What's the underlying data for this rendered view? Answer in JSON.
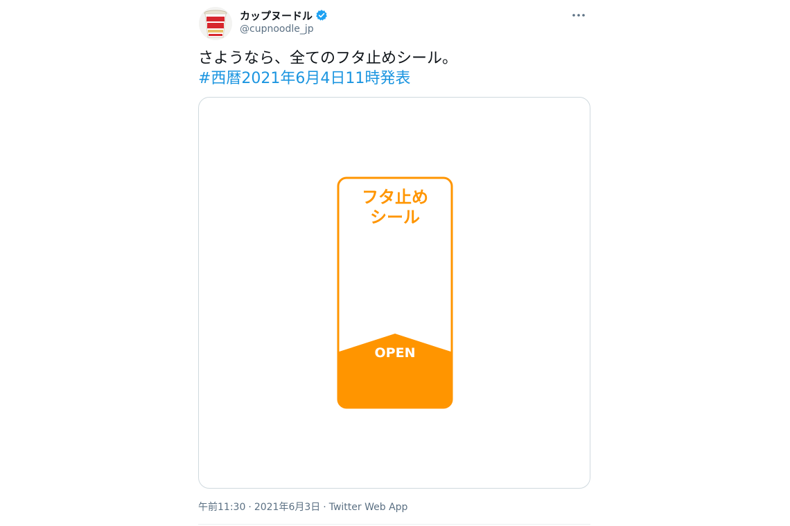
{
  "author": {
    "display_name": "カップヌードル",
    "handle": "@cupnoodle_jp",
    "verified": true,
    "avatar_icon": "cup-noodle-avatar-icon"
  },
  "more_icon": "more-horizontal-icon",
  "tweet": {
    "text": "さようなら、全てのフタ止めシール。",
    "hashtag": "#西暦2021年6月4日11時発表"
  },
  "media": {
    "seal_title_line1": "フタ止め",
    "seal_title_line2": "シール",
    "seal_open_label": "OPEN",
    "colors": {
      "orange": "#ff9500",
      "white": "#ffffff"
    }
  },
  "meta": {
    "time": "午前11:30",
    "date": "2021年6月3日",
    "separator": "·",
    "source": "Twitter Web App"
  },
  "colors": {
    "link": "#1b95e0",
    "secondary_text": "#5b7083",
    "verified": "#1da1f2"
  }
}
